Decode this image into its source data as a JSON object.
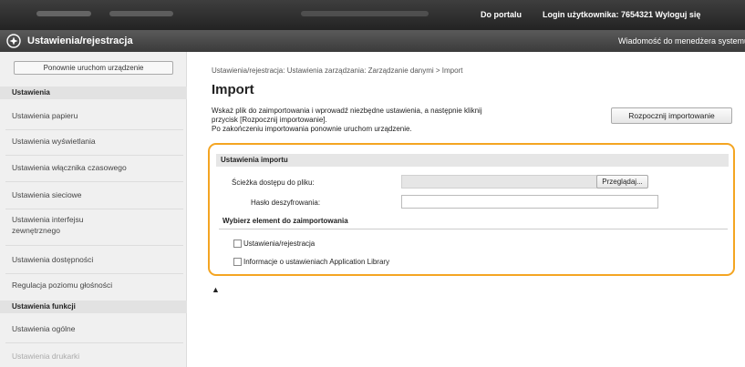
{
  "topbar": {
    "portal": "Do portalu",
    "login": "Login użytkownika:  7654321  Wyloguj się"
  },
  "titlebar": {
    "title": "Ustawienia/rejestracja",
    "message": "Wiadomość do menedżera systemu"
  },
  "sidebar": {
    "restart": "Ponownie uruchom urządzenie",
    "section1": "Ustawienia",
    "items1": [
      "Ustawienia papieru",
      "Ustawienia wyświetlania",
      "Ustawienia włącznika czasowego",
      "Ustawienia sieciowe",
      "Ustawienia interfejsu zewnętrznego",
      "Ustawienia dostępności",
      "Regulacja poziomu głośności"
    ],
    "section2": "Ustawienia funkcji",
    "items2": [
      "Ustawienia ogólne",
      "Ustawienia drukarki"
    ]
  },
  "main": {
    "breadcrumb": "Ustawienia/rejestracja: Ustawienia zarządzania: Zarządzanie danymi > Import",
    "title": "Import",
    "desc_line1": "Wskaż plik do zaimportowania i wprowadź niezbędne ustawienia, a następnie kliknij",
    "desc_line2": "przycisk [Rozpocznij importowanie].",
    "desc_line3": "Po zakończeniu importowania ponownie uruchom urządzenie.",
    "start_button": "Rozpocznij importowanie"
  },
  "panel": {
    "heading": "Ustawienia importu",
    "path_label": "Ścieżka dostępu do pliku:",
    "browse": "Przeglądaj...",
    "password_label": "Hasło deszyfrowania:",
    "select_heading": "Wybierz element do zaimportowania",
    "options": [
      "Ustawienia/rejestracja",
      "Informacje o ustawieniach Application Library"
    ]
  },
  "top_link": "▲"
}
